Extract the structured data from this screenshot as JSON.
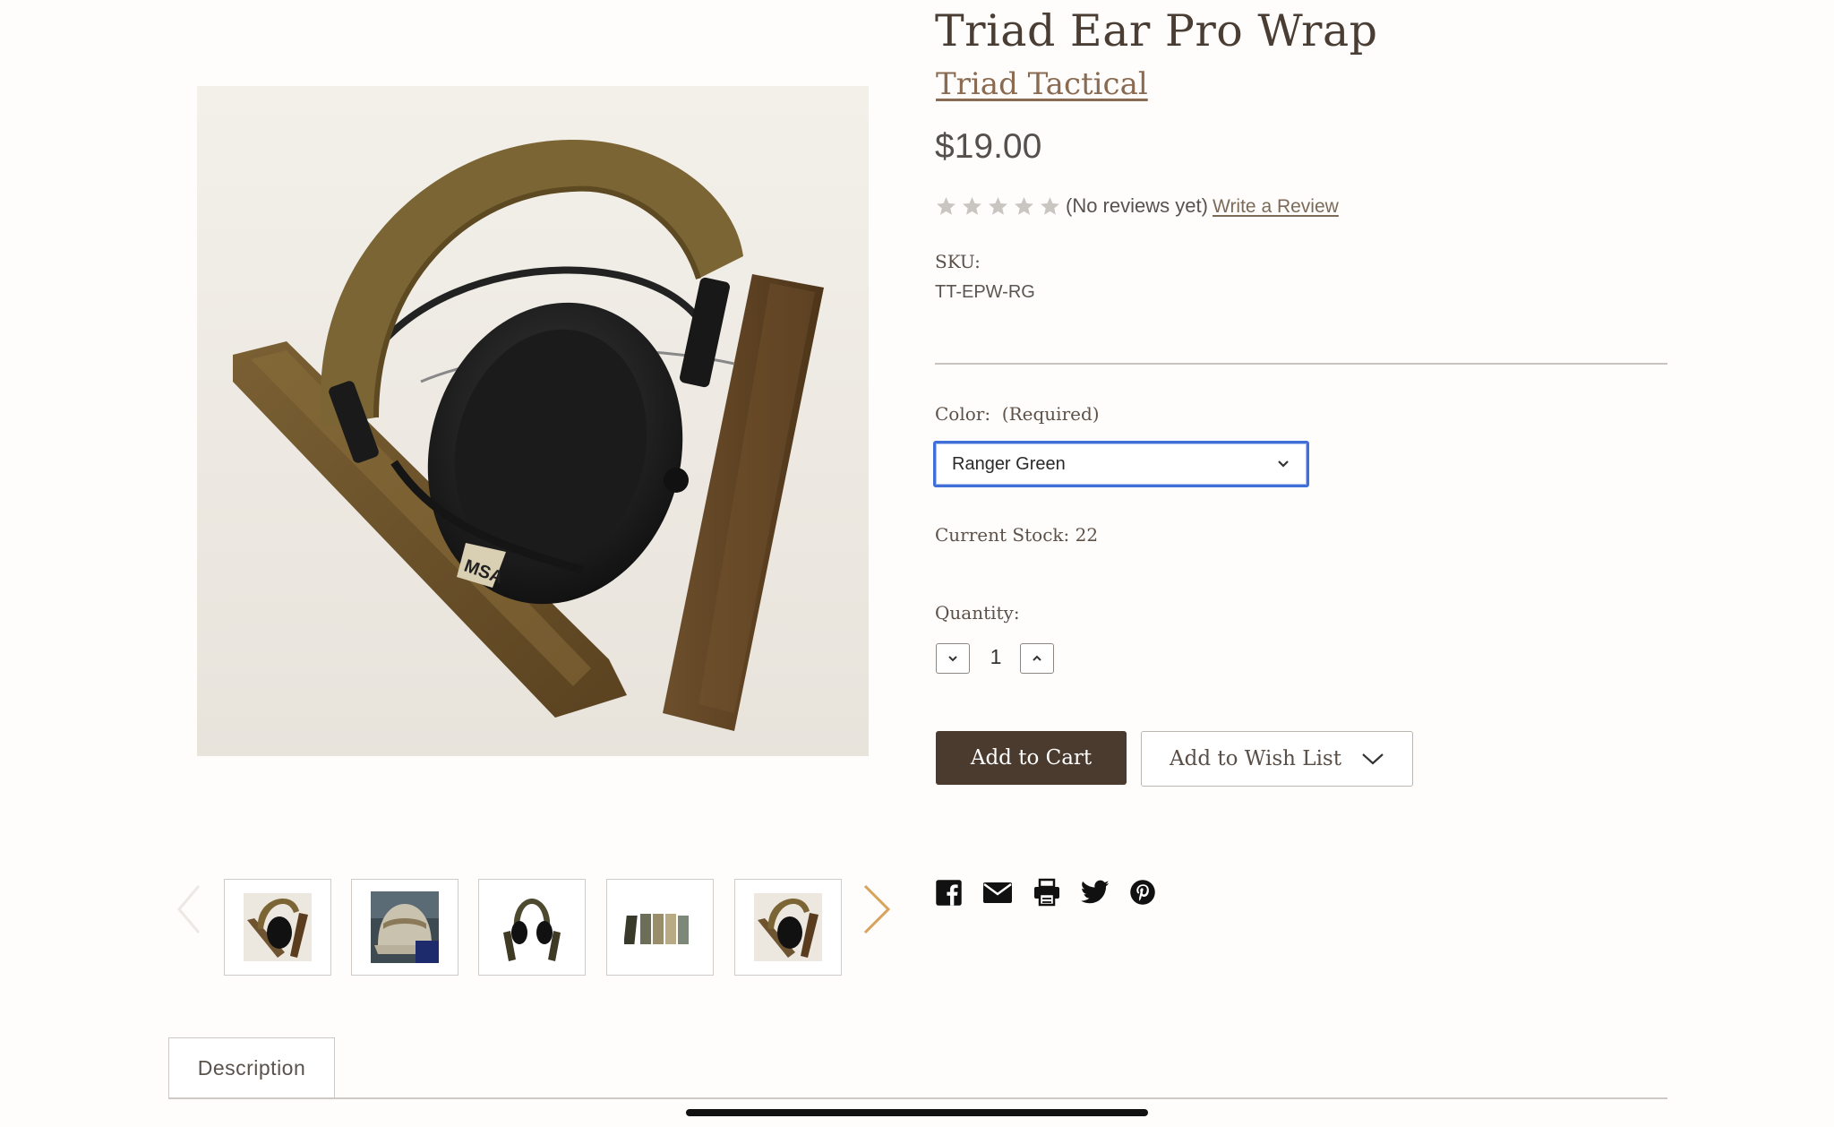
{
  "product": {
    "title": "Triad Ear Pro Wrap",
    "brand": "Triad Tactical",
    "price": "$19.00",
    "rating": {
      "stars": 0,
      "max_stars": 5,
      "reviews_text": "(No reviews yet)",
      "write_review_label": "Write a Review"
    },
    "sku_label": "SKU:",
    "sku_value": "TT-EPW-RG"
  },
  "options": {
    "color_label": "Color:  (Required)",
    "color_selected": "Ranger Green",
    "stock_text": "Current Stock: 22",
    "quantity_label": "Quantity:",
    "quantity_value": "1"
  },
  "actions": {
    "add_to_cart": "Add to Cart",
    "add_to_wish_list": "Add to Wish List"
  },
  "gallery": {
    "thumbnails": [
      {
        "icon": "headphones-with-wraps"
      },
      {
        "icon": "cap-with-wrap"
      },
      {
        "icon": "headphones-with-wraps-top"
      },
      {
        "icon": "wraps-lineup"
      },
      {
        "icon": "headphones-with-wraps"
      }
    ]
  },
  "share": {
    "icons": [
      "facebook-icon",
      "email-icon",
      "print-icon",
      "twitter-icon",
      "pinterest-icon"
    ]
  },
  "tabs": {
    "description": "Description"
  },
  "colors": {
    "accent_brown": "#4b3b2f",
    "brand_link": "#8a6a50",
    "select_focus": "#3f6fd7",
    "arrow_gold": "#d7a25a"
  }
}
